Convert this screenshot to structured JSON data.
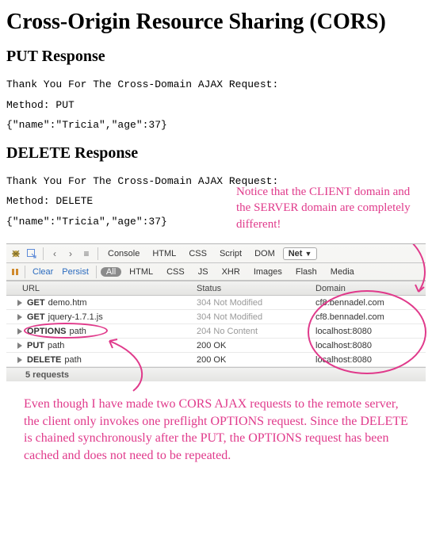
{
  "title": "Cross-Origin Resource Sharing (CORS)",
  "sections": {
    "put": {
      "heading": "PUT Response",
      "thanks": "Thank You For The Cross-Domain AJAX Request:",
      "method": "Method: PUT",
      "body": "{\"name\":\"Tricia\",\"age\":37}"
    },
    "delete": {
      "heading": "DELETE Response",
      "thanks": "Thank You For The Cross-Domain AJAX Request:",
      "method": "Method: DELETE",
      "body": "{\"name\":\"Tricia\",\"age\":37}"
    }
  },
  "devtools": {
    "main_tabs": [
      "Console",
      "HTML",
      "CSS",
      "Script",
      "DOM"
    ],
    "net_tab": "Net",
    "row2_btns": [
      "Clear",
      "Persist"
    ],
    "filters": [
      "All",
      "HTML",
      "CSS",
      "JS",
      "XHR",
      "Images",
      "Flash",
      "Media"
    ],
    "filter_selected": "All",
    "columns": {
      "url": "URL",
      "status": "Status",
      "domain": "Domain"
    },
    "rows": [
      {
        "method": "GET",
        "url": "demo.htm",
        "status": "304 Not Modified",
        "status_gray": true,
        "domain": "cf8.bennadel.com"
      },
      {
        "method": "GET",
        "url": "jquery-1.7.1.js",
        "status": "304 Not Modified",
        "status_gray": true,
        "domain": "cf8.bennadel.com"
      },
      {
        "method": "OPTIONS",
        "url": "path",
        "status": "204 No Content",
        "status_gray": true,
        "domain": "localhost:8080"
      },
      {
        "method": "PUT",
        "url": "path",
        "status": "200 OK",
        "status_gray": false,
        "domain": "localhost:8080"
      },
      {
        "method": "DELETE",
        "url": "path",
        "status": "200 OK",
        "status_gray": false,
        "domain": "localhost:8080"
      }
    ],
    "summary": "5 requests"
  },
  "annotations": {
    "top": "Notice that the CLIENT domain and the SERVER domain are completely different!",
    "bottom": "Even though I have made two CORS AJAX requests to the remote server, the client only invokes one preflight OPTIONS request. Since the DELETE is chained synchronously after the PUT, the OPTIONS request has been cached and does not need to be repeated."
  }
}
